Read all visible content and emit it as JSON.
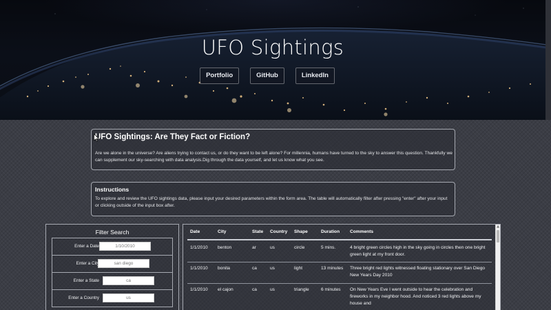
{
  "hero": {
    "title": "UFO Sightings",
    "nav": [
      {
        "label": "Portfolio"
      },
      {
        "label": "GitHub"
      },
      {
        "label": "LinkedIn"
      }
    ]
  },
  "intro": {
    "heading": "UFO Sightings: Are They Fact or Fiction?",
    "body": "Are we alone in the universe? Are aliens trying to contact us, or do they want to be left alone? For millennia, humans have turned to the sky to answer this question. Thankfully we can supplement our sky-searching with data analysis.Dig through the data yourself, and let us know what you see."
  },
  "instructions": {
    "heading": "Instructions",
    "body": "To explore and review the UFO sightings data, please input your desired parameters within the form area. The table will automatically filter after pressing \"enter\" after your input or clicking outside of the input box after."
  },
  "filter": {
    "title": "Filter Search",
    "fields": [
      {
        "label": "Enter a Date",
        "placeholder": "1/10/2010"
      },
      {
        "label": "Enter a City",
        "placeholder": "san diego"
      },
      {
        "label": "Enter a State",
        "placeholder": "ca"
      },
      {
        "label": "Enter a Country",
        "placeholder": "us"
      }
    ]
  },
  "table": {
    "headers": [
      "Date",
      "City",
      "State",
      "Country",
      "Shape",
      "Duration",
      "Comments"
    ],
    "rows": [
      [
        "1/1/2010",
        "benton",
        "ar",
        "us",
        "circle",
        "5 mins.",
        "4 bright green circles high in the sky going in circles then one bright green light at my front door."
      ],
      [
        "1/1/2010",
        "bonita",
        "ca",
        "us",
        "light",
        "13 minutes",
        "Three bright red lights witnessed floating stationary over San Diego New Years Day 2010"
      ],
      [
        "1/1/2010",
        "el cajon",
        "ca",
        "us",
        "triangle",
        "6 minutes",
        "On New Years Eve I went outside to hear the celebration and fireworks in my neighbor hood. And noticed 3 red lights above my house and"
      ]
    ]
  },
  "colors": {
    "page_bg": "#3b3d45",
    "panel_border": "#a7aab2",
    "text": "#ffffff"
  }
}
